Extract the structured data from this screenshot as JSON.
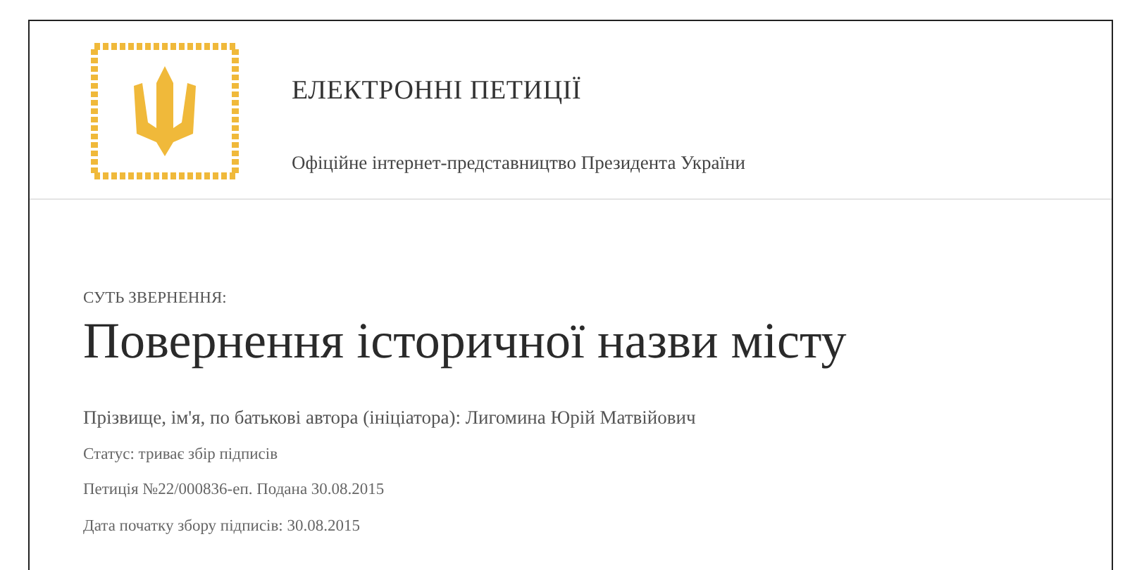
{
  "header": {
    "title": "ЕЛЕКТРОННІ ПЕТИЦІЇ",
    "subtitle": "Офіційне інтернет-представництво Президента України"
  },
  "petition": {
    "label": "СУТЬ ЗВЕРНЕННЯ:",
    "title": "Повернення історичної назви місту",
    "author": "Прізвище, ім'я, по батькові автора (ініціатора): Лигомина Юрій Матвійович",
    "details": [
      "Статус: триває збір підписів",
      "Петиція №22/000836-еп. Подана 30.08.2015",
      "Дата початку збору підписів: 30.08.2015"
    ]
  }
}
